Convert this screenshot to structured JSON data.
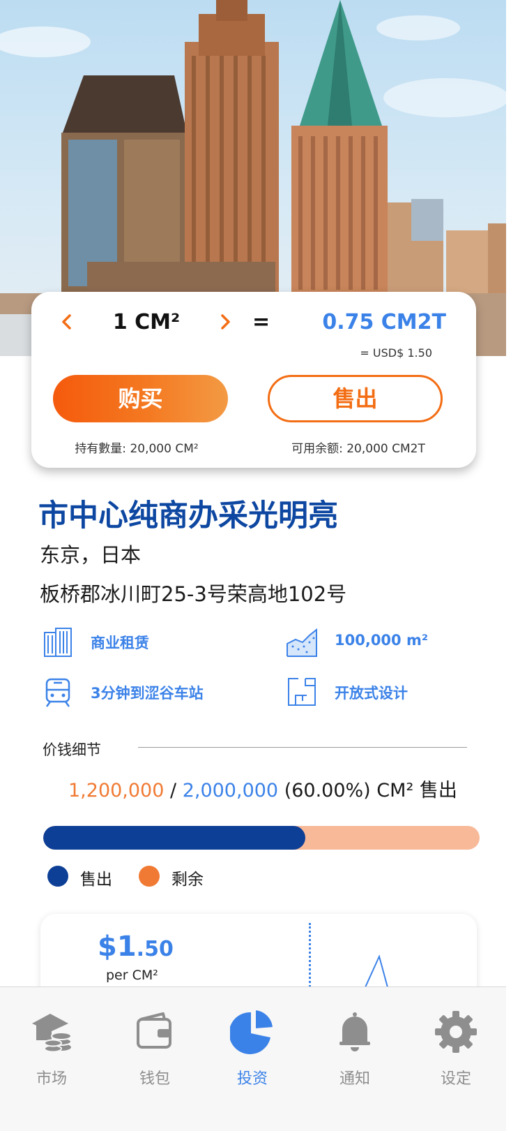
{
  "exchange": {
    "unit_label": "1 CM²",
    "equals": "=",
    "token_value": "0.75 CM2T",
    "usd_value": "= USD$  1.50",
    "buy_label": "购买",
    "sell_label": "售出",
    "holdings": "持有數量: 20,000 CM²",
    "available": "可用余额: 20,000 CM2T"
  },
  "property": {
    "title": "市中心纯商办采光明亮",
    "city": "东京，日本",
    "address": "板桥郡冰川町25-3号荣高地102号",
    "features": [
      {
        "icon": "office-building-icon",
        "label": "商业租赁"
      },
      {
        "icon": "area-chart-icon",
        "label": "100,000 m²"
      },
      {
        "icon": "train-icon",
        "label": "3分钟到涩谷车站"
      },
      {
        "icon": "floor-plan-icon",
        "label": "开放式设计"
      }
    ]
  },
  "price_detail": {
    "label": "价钱细节",
    "sold": "1,200,000",
    "separator": " / ",
    "total": "2,000,000",
    "suffix": " (60.00%) CM² 售出",
    "progress_fraction": 0.6,
    "legend_sold": "售出",
    "legend_remaining": "剩余"
  },
  "price_card": {
    "price_major": "$1",
    "price_minor": ".50",
    "per_unit": "per CM²"
  },
  "tabs": [
    {
      "label": "市场",
      "icon": "market-icon",
      "active": false
    },
    {
      "label": "钱包",
      "icon": "wallet-icon",
      "active": false
    },
    {
      "label": "投资",
      "icon": "pie-chart-icon",
      "active": true
    },
    {
      "label": "通知",
      "icon": "bell-icon",
      "active": false
    },
    {
      "label": "设定",
      "icon": "gear-icon",
      "active": false
    }
  ],
  "colors": {
    "brand_blue": "#0d47a1",
    "accent_blue": "#3b82e8",
    "accent_orange": "#f36d14",
    "progress_sold": "#0d3f96",
    "progress_remaining": "#f8b999",
    "tab_inactive": "#8e8e8e"
  }
}
